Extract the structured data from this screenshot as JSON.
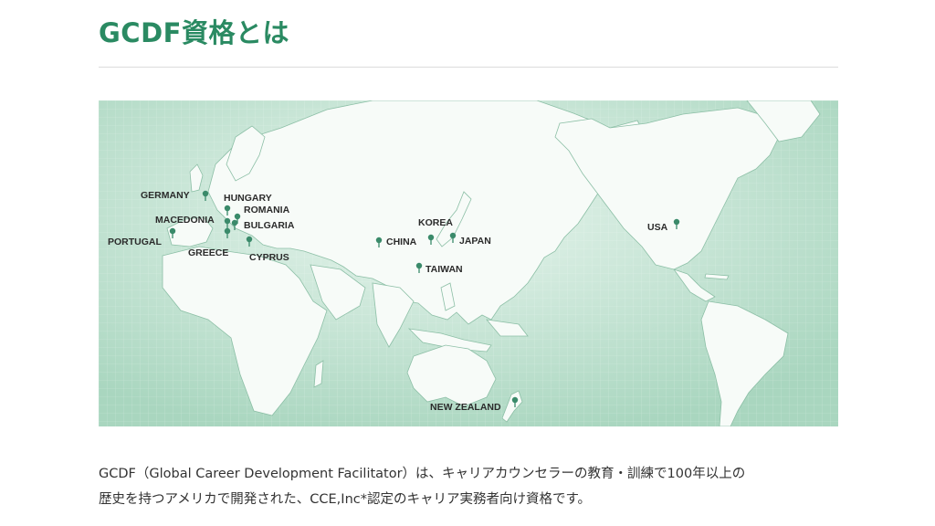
{
  "page": {
    "title": "GCDF資格とは"
  },
  "map": {
    "colors": {
      "ocean": "#bfe2d0",
      "land": "#f7fbf8",
      "marker": "#3a8a6a",
      "coast": "#8cbfa6"
    },
    "markers": [
      {
        "id": "germany",
        "label": "GERMANY"
      },
      {
        "id": "hungary",
        "label": "HUNGARY"
      },
      {
        "id": "romania",
        "label": "ROMANIA"
      },
      {
        "id": "macedonia",
        "label": "MACEDONIA"
      },
      {
        "id": "bulgaria",
        "label": "BULGARIA"
      },
      {
        "id": "portugal",
        "label": "PORTUGAL"
      },
      {
        "id": "greece",
        "label": "GREECE"
      },
      {
        "id": "cyprus",
        "label": "CYPRUS"
      },
      {
        "id": "korea",
        "label": "KOREA"
      },
      {
        "id": "china",
        "label": "CHINA"
      },
      {
        "id": "japan",
        "label": "JAPAN"
      },
      {
        "id": "taiwan",
        "label": "TAIWAN"
      },
      {
        "id": "usa",
        "label": "USA"
      },
      {
        "id": "new-zealand",
        "label": "NEW ZEALAND"
      }
    ]
  },
  "description": {
    "line1": "GCDF（Global Career Development Facilitator）は、キャリアカウンセラーの教育・訓練で100年以上の",
    "line2": "歴史を持つアメリカで開発された、CCE,Inc*認定のキャリア実務者向け資格です。"
  }
}
